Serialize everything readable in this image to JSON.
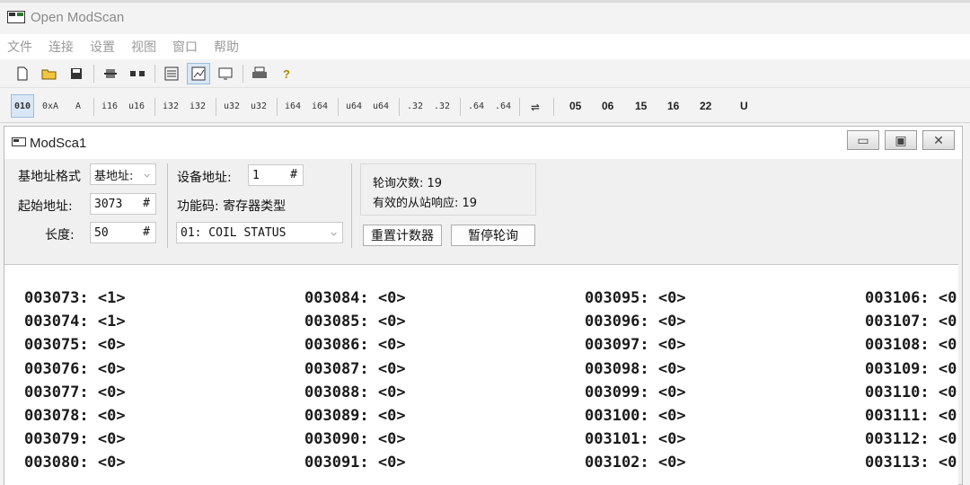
{
  "window": {
    "title": "Open ModScan"
  },
  "menu": [
    "文件",
    "连接",
    "设置",
    "视图",
    "窗口",
    "帮助"
  ],
  "toolbar1": {
    "icons": [
      "new-file-icon",
      "open-folder-icon",
      "save-icon",
      "connect-icon",
      "disconnect-icon",
      "display-options-icon",
      "graph-icon",
      "monitor-icon",
      "print-icon",
      "help-icon"
    ]
  },
  "toolbar2": {
    "formats": [
      "010",
      "0xA",
      "A",
      "i16",
      "u16",
      "i32",
      "i32",
      "u32",
      "u32",
      "i64",
      "i64",
      "u64",
      "u64",
      ".32",
      ".32",
      ".64",
      ".64"
    ],
    "swap_icon": "⇌",
    "function_codes": [
      "05",
      "06",
      "15",
      "16",
      "22",
      "U"
    ]
  },
  "child": {
    "title": "ModSca1",
    "minimize": "▭",
    "restore": "▣",
    "close": "✕"
  },
  "form": {
    "base_format_label": "基地址格式",
    "base_format_value": "基地址:",
    "start_address_label": "起始地址:",
    "start_address_value": "3073",
    "length_label": "长度:",
    "length_value": "50",
    "device_address_label": "设备地址:",
    "device_address_value": "1",
    "function_code_label": "功能码: 寄存器类型",
    "function_code_value": "01: COIL STATUS",
    "hash": "#",
    "poll_count": "轮询次数: 19",
    "valid_responses": "有效的从站响应: 19",
    "reset_counter_button": "重置计数器",
    "pause_polling_button": "暂停轮询"
  },
  "data_columns": [
    [
      "003073: <1>",
      "003074: <1>",
      "003075: <0>",
      "003076: <0>",
      "003077: <0>",
      "003078: <0>",
      "003079: <0>",
      "003080: <0>"
    ],
    [
      "003084: <0>",
      "003085: <0>",
      "003086: <0>",
      "003087: <0>",
      "003088: <0>",
      "003089: <0>",
      "003090: <0>",
      "003091: <0>"
    ],
    [
      "003095: <0>",
      "003096: <0>",
      "003097: <0>",
      "003098: <0>",
      "003099: <0>",
      "003100: <0>",
      "003101: <0>",
      "003102: <0>"
    ],
    [
      "003106: <0",
      "003107: <0",
      "003108: <0",
      "003109: <0",
      "003110: <0",
      "003111: <0",
      "003112: <0",
      "003113: <0"
    ]
  ]
}
